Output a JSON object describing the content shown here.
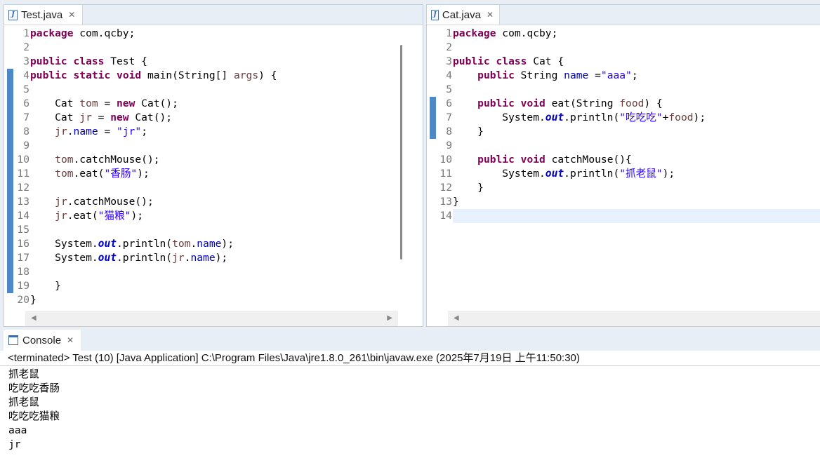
{
  "left_editor": {
    "tab_title": "Test.java",
    "lines": [
      {
        "n": "1",
        "tokens": [
          {
            "t": "package",
            "c": "kw"
          },
          {
            "t": " com.qcby;"
          }
        ]
      },
      {
        "n": "2",
        "tokens": []
      },
      {
        "n": "3",
        "tokens": [
          {
            "t": "public",
            "c": "kw"
          },
          {
            "t": " "
          },
          {
            "t": "class",
            "c": "kw"
          },
          {
            "t": " Test {"
          }
        ]
      },
      {
        "n": "4",
        "tokens": [
          {
            "t": "public",
            "c": "kw"
          },
          {
            "t": " "
          },
          {
            "t": "static",
            "c": "kw"
          },
          {
            "t": " "
          },
          {
            "t": "void",
            "c": "kw"
          },
          {
            "t": " main(String[] "
          },
          {
            "t": "args",
            "c": "par"
          },
          {
            "t": ") {"
          }
        ]
      },
      {
        "n": "5",
        "tokens": []
      },
      {
        "n": "6",
        "tokens": [
          {
            "t": "    Cat "
          },
          {
            "t": "tom",
            "c": "loc"
          },
          {
            "t": " = "
          },
          {
            "t": "new",
            "c": "kw"
          },
          {
            "t": " Cat();"
          }
        ]
      },
      {
        "n": "7",
        "tokens": [
          {
            "t": "    Cat "
          },
          {
            "t": "jr",
            "c": "loc"
          },
          {
            "t": " = "
          },
          {
            "t": "new",
            "c": "kw"
          },
          {
            "t": " Cat();"
          }
        ]
      },
      {
        "n": "8",
        "tokens": [
          {
            "t": "    "
          },
          {
            "t": "jr",
            "c": "loc"
          },
          {
            "t": "."
          },
          {
            "t": "name",
            "c": "fld"
          },
          {
            "t": " = "
          },
          {
            "t": "\"jr\"",
            "c": "str"
          },
          {
            "t": ";"
          }
        ]
      },
      {
        "n": "9",
        "tokens": []
      },
      {
        "n": "10",
        "tokens": [
          {
            "t": "    "
          },
          {
            "t": "tom",
            "c": "loc"
          },
          {
            "t": ".catchMouse();"
          }
        ]
      },
      {
        "n": "11",
        "tokens": [
          {
            "t": "    "
          },
          {
            "t": "tom",
            "c": "loc"
          },
          {
            "t": ".eat("
          },
          {
            "t": "\"香肠\"",
            "c": "str"
          },
          {
            "t": ");"
          }
        ]
      },
      {
        "n": "12",
        "tokens": []
      },
      {
        "n": "13",
        "tokens": [
          {
            "t": "    "
          },
          {
            "t": "jr",
            "c": "loc"
          },
          {
            "t": ".catchMouse();"
          }
        ]
      },
      {
        "n": "14",
        "tokens": [
          {
            "t": "    "
          },
          {
            "t": "jr",
            "c": "loc"
          },
          {
            "t": ".eat("
          },
          {
            "t": "\"猫粮\"",
            "c": "str"
          },
          {
            "t": ");"
          }
        ]
      },
      {
        "n": "15",
        "tokens": []
      },
      {
        "n": "16",
        "tokens": [
          {
            "t": "    System."
          },
          {
            "t": "out",
            "c": "sfld"
          },
          {
            "t": ".println("
          },
          {
            "t": "tom",
            "c": "loc"
          },
          {
            "t": "."
          },
          {
            "t": "name",
            "c": "fld"
          },
          {
            "t": ");"
          }
        ]
      },
      {
        "n": "17",
        "tokens": [
          {
            "t": "    System."
          },
          {
            "t": "out",
            "c": "sfld"
          },
          {
            "t": ".println("
          },
          {
            "t": "jr",
            "c": "loc"
          },
          {
            "t": "."
          },
          {
            "t": "name",
            "c": "fld"
          },
          {
            "t": ");"
          }
        ]
      },
      {
        "n": "18",
        "tokens": []
      },
      {
        "n": "19",
        "tokens": [
          {
            "t": "    }"
          }
        ]
      },
      {
        "n": "20",
        "tokens": [
          {
            "t": "}"
          }
        ]
      }
    ]
  },
  "right_editor": {
    "tab_title": "Cat.java",
    "lines": [
      {
        "n": "1",
        "tokens": [
          {
            "t": "package",
            "c": "kw"
          },
          {
            "t": " com.qcby;"
          }
        ]
      },
      {
        "n": "2",
        "tokens": []
      },
      {
        "n": "3",
        "tokens": [
          {
            "t": "public",
            "c": "kw"
          },
          {
            "t": " "
          },
          {
            "t": "class",
            "c": "kw"
          },
          {
            "t": " Cat {"
          }
        ]
      },
      {
        "n": "4",
        "tokens": [
          {
            "t": "    "
          },
          {
            "t": "public",
            "c": "kw"
          },
          {
            "t": " String "
          },
          {
            "t": "name",
            "c": "fld"
          },
          {
            "t": " ="
          },
          {
            "t": "\"aaa\"",
            "c": "str"
          },
          {
            "t": ";"
          }
        ]
      },
      {
        "n": "5",
        "tokens": []
      },
      {
        "n": "6",
        "tokens": [
          {
            "t": "    "
          },
          {
            "t": "public",
            "c": "kw"
          },
          {
            "t": " "
          },
          {
            "t": "void",
            "c": "kw"
          },
          {
            "t": " eat(String "
          },
          {
            "t": "food",
            "c": "par"
          },
          {
            "t": ") {"
          }
        ]
      },
      {
        "n": "7",
        "tokens": [
          {
            "t": "        System."
          },
          {
            "t": "out",
            "c": "sfld"
          },
          {
            "t": ".println("
          },
          {
            "t": "\"吃吃吃\"",
            "c": "str"
          },
          {
            "t": "+"
          },
          {
            "t": "food",
            "c": "par"
          },
          {
            "t": ");"
          }
        ]
      },
      {
        "n": "8",
        "tokens": [
          {
            "t": "    }"
          }
        ]
      },
      {
        "n": "9",
        "tokens": []
      },
      {
        "n": "10",
        "tokens": [
          {
            "t": "    "
          },
          {
            "t": "public",
            "c": "kw"
          },
          {
            "t": " "
          },
          {
            "t": "void",
            "c": "kw"
          },
          {
            "t": " catchMouse(){"
          }
        ]
      },
      {
        "n": "11",
        "tokens": [
          {
            "t": "        System."
          },
          {
            "t": "out",
            "c": "sfld"
          },
          {
            "t": ".println("
          },
          {
            "t": "\"抓老鼠\"",
            "c": "str"
          },
          {
            "t": ");"
          }
        ]
      },
      {
        "n": "12",
        "tokens": [
          {
            "t": "    }"
          }
        ]
      },
      {
        "n": "13",
        "tokens": [
          {
            "t": "}"
          }
        ]
      },
      {
        "n": "14",
        "tokens": []
      }
    ]
  },
  "console": {
    "tab_title": "Console",
    "header": "<terminated> Test (10) [Java Application] C:\\Program Files\\Java\\jre1.8.0_261\\bin\\javaw.exe (2025年7月19日 上午11:50:30)",
    "output": [
      "抓老鼠",
      "吃吃吃香肠",
      "抓老鼠",
      "吃吃吃猫粮",
      "aaa",
      "jr"
    ]
  }
}
